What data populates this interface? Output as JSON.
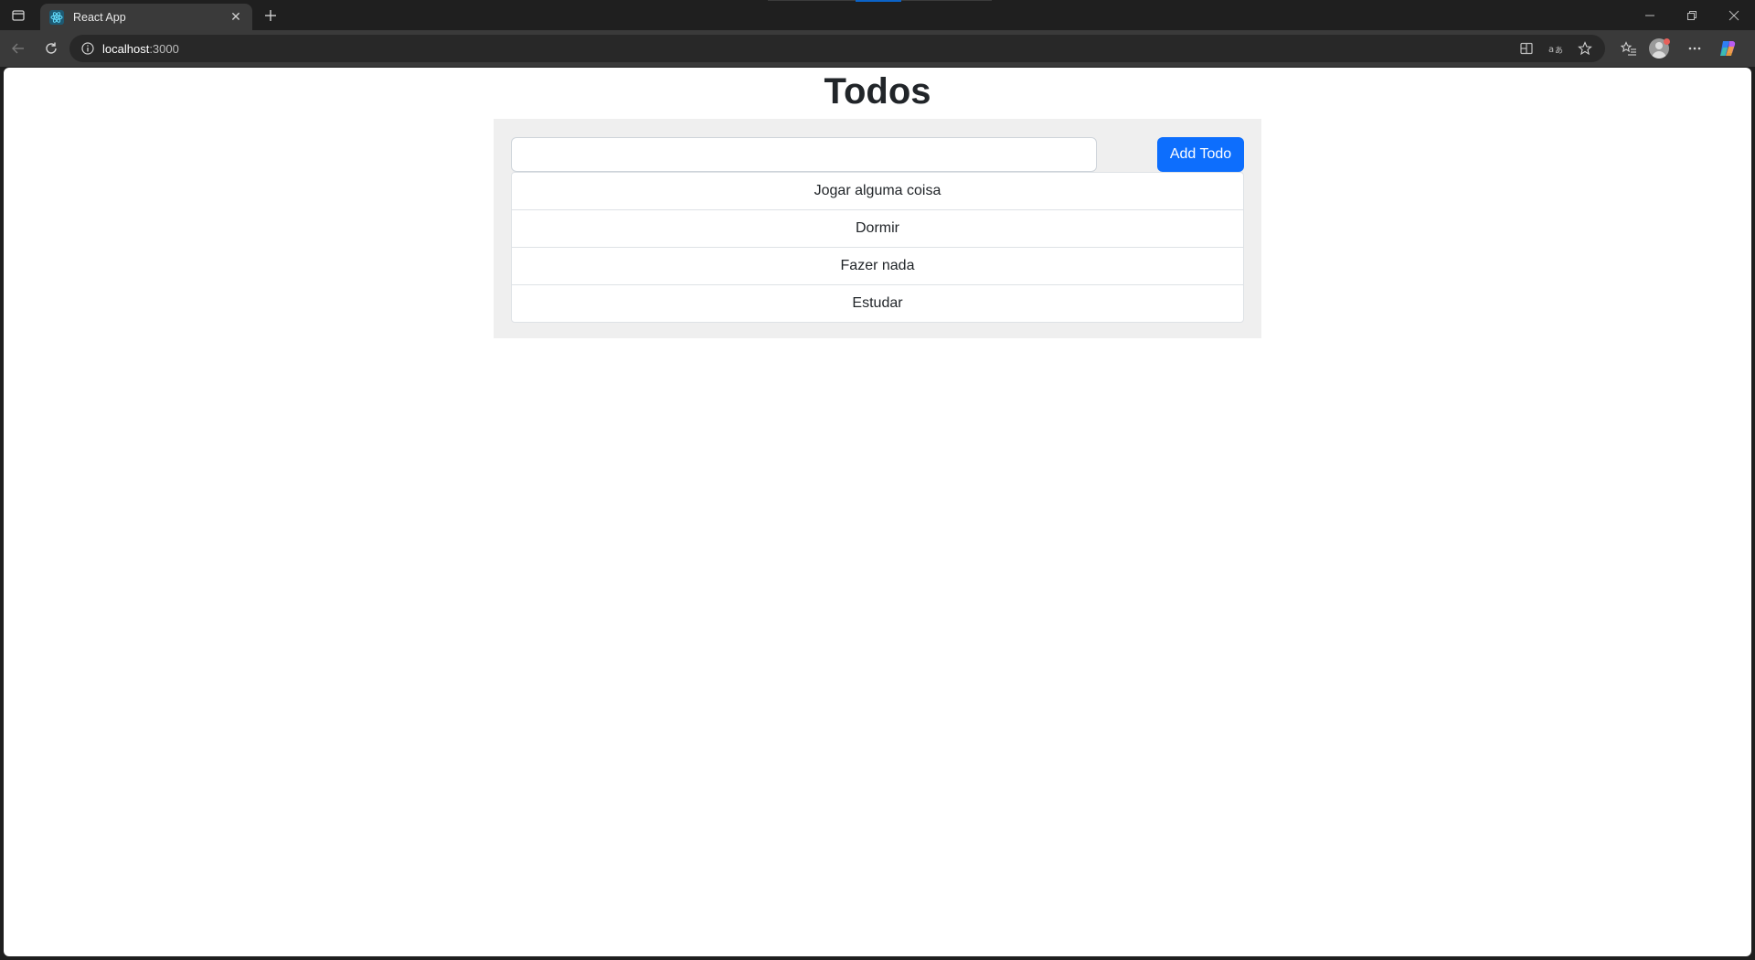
{
  "browser": {
    "tab": {
      "title": "React App"
    },
    "address": {
      "host": "localhost",
      "port": ":3000"
    }
  },
  "page": {
    "heading": "Todos",
    "input": {
      "value": "",
      "placeholder": ""
    },
    "add_button_label": "Add Todo",
    "todos": [
      {
        "text": "Jogar alguma coisa"
      },
      {
        "text": "Dormir"
      },
      {
        "text": "Fazer nada"
      },
      {
        "text": "Estudar"
      }
    ]
  },
  "colors": {
    "primary_button": "#0d6efd",
    "panel_bg": "#efefef",
    "browser_chrome": "#3a3a3a"
  }
}
